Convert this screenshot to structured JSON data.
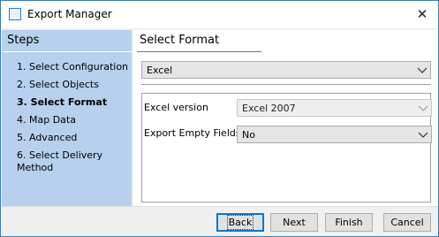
{
  "window": {
    "title": "Export Manager",
    "close_glyph": "✕"
  },
  "steps": {
    "header": "Steps",
    "items": [
      {
        "label": "1. Select Configuration",
        "active": false
      },
      {
        "label": "2. Select Objects",
        "active": false
      },
      {
        "label": "3. Select Format",
        "active": true
      },
      {
        "label": "4. Map Data",
        "active": false
      },
      {
        "label": "5. Advanced",
        "active": false
      },
      {
        "label": "6. Select Delivery Method",
        "active": false
      }
    ]
  },
  "main": {
    "section_title": "Select Format",
    "format_select": {
      "value": "Excel"
    },
    "options": {
      "excel_version": {
        "label": "Excel version",
        "value": "Excel 2007",
        "enabled": false
      },
      "export_empty_fields": {
        "label": "Export Empty Fields",
        "value": "No",
        "enabled": true
      }
    }
  },
  "buttons": {
    "back": "Back",
    "next": "Next",
    "finish": "Finish",
    "cancel": "Cancel"
  },
  "colors": {
    "steps_bg": "#b6d0ee",
    "accent": "#0078d7",
    "window_border": "#3c7fb1"
  }
}
